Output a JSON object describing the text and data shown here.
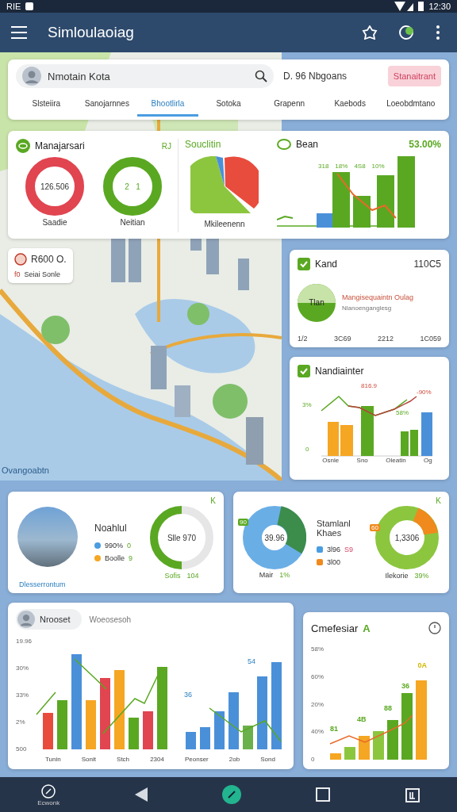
{
  "status_bar": {
    "carrier": "RIE",
    "time": "12:30"
  },
  "app_bar": {
    "title": "Simloulaoiag"
  },
  "search_card": {
    "value": "Nmotain Kota",
    "filter": "D. 96 Nbgoans",
    "action": "Stanaitrant"
  },
  "tabs": [
    {
      "label": "Slsteiira",
      "selected": false
    },
    {
      "label": "Sanojarnnes",
      "selected": false
    },
    {
      "label": "Bhootlirla",
      "selected": true
    },
    {
      "label": "Sotoka",
      "selected": false
    },
    {
      "label": "Grapenn",
      "selected": false
    },
    {
      "label": "Kaebods",
      "selected": false
    },
    {
      "label": "Loeobdmtano",
      "selected": false
    }
  ],
  "summary": {
    "title": "Manajarsari",
    "corner": "RJ",
    "donuts": [
      {
        "center": "126.506",
        "label": "Saadie",
        "color": "#e04550"
      },
      {
        "center": "2   1",
        "label": "Neitian",
        "color": "#5aa822"
      }
    ],
    "pie": {
      "title": "Souclitin",
      "label": "Mkileenenn"
    },
    "bars": {
      "title": "Bean",
      "total": "53.00%",
      "labels": [
        "318",
        "18%",
        "4S8",
        "10%"
      ]
    }
  },
  "map": {
    "legend_title": "R600 O.",
    "legend_marker": "f0",
    "legend_text": "Seiai Sonle",
    "label": "Ovangoabtn"
  },
  "side_cards": [
    {
      "title": "Kand",
      "value": "110C5",
      "donut_label": "Tlan",
      "headline": "Mangisequaintn Oulag",
      "subline": "Nlanoenganglesg",
      "stats": [
        "1/2",
        "3C69",
        "2212",
        "1C059"
      ]
    },
    {
      "title": "Nandiainter",
      "labels": [
        "816.9",
        "-90%",
        "3%",
        "58%",
        "0"
      ],
      "x_labels": [
        "Osnle",
        "Sno",
        "Oleatin",
        "Og"
      ]
    }
  ],
  "mid_cards": [
    {
      "title": "Noahlul",
      "corner": "K",
      "legend": [
        {
          "text": "990%",
          "value": "0",
          "color": "#4a9de0"
        },
        {
          "text": "Boolle",
          "value": "9",
          "color": "#f5a623"
        }
      ],
      "link": "Dlesserrontum",
      "donut_center": "Slle 970",
      "footer_text": "Sofis",
      "footer_value": "104"
    },
    {
      "title": "Stamlanl Khaes",
      "corner": "K",
      "pie_center": "39.96",
      "pie_tag": "90",
      "legend": [
        {
          "text": "3l96",
          "value": "S9",
          "color": "#4a9de0"
        },
        {
          "text": "3l00",
          "color": "#f08a1c"
        }
      ],
      "footer_text": "Mair",
      "footer_value": "1%",
      "donut_center": "1,3306",
      "donut_tag": "60",
      "donut_footer": "Ilekorie",
      "donut_value": "39%"
    }
  ],
  "trend_card": {
    "user": "Nrooset",
    "subtitle": "Woeosesoh",
    "yticks": [
      "19.96",
      "30%",
      "33%",
      "2%",
      "500"
    ],
    "x_labels": [
      "Tunin",
      "Sonit",
      "Stch",
      "2304",
      "Peonser",
      "2ob",
      "Sond"
    ],
    "tags": [
      "36",
      "54"
    ]
  },
  "growth_card": {
    "title": "Cmefesiar",
    "mark": "A",
    "yticks": [
      "58%",
      "60%",
      "20%",
      "40%",
      "0"
    ],
    "tags": [
      "0A",
      "36",
      "88",
      "4B",
      "81"
    ]
  },
  "nav_bar": {
    "caption": "Ecwonk"
  }
}
